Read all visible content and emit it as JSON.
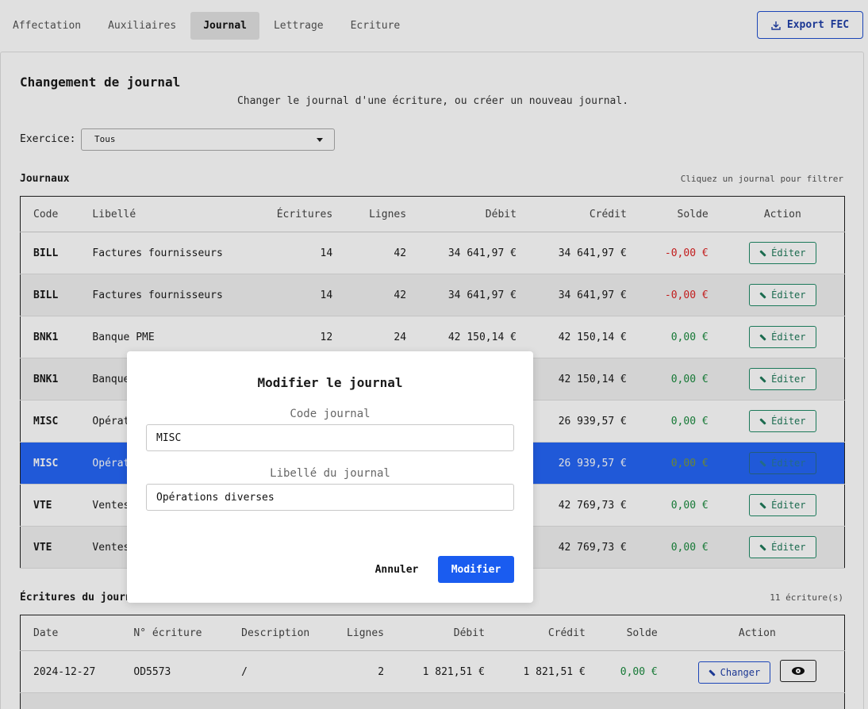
{
  "tabs": [
    {
      "label": "Affectation"
    },
    {
      "label": "Auxiliaires"
    },
    {
      "label": "Journal"
    },
    {
      "label": "Lettrage"
    },
    {
      "label": "Ecriture"
    }
  ],
  "export_label": "Export FEC",
  "page": {
    "title": "Changement de journal",
    "subtitle": "Changer le journal d'une écriture, ou créer un nouveau journal.",
    "exercice_label": "Exercice:",
    "exercice_value": "Tous"
  },
  "journaux": {
    "title": "Journaux",
    "hint": "Cliquez un journal pour filtrer",
    "headers": [
      "Code",
      "Libellé",
      "Écritures",
      "Lignes",
      "Débit",
      "Crédit",
      "Solde",
      "Action"
    ],
    "edit_label": "Éditer",
    "rows": [
      {
        "code": "BILL",
        "libelle": "Factures fournisseurs",
        "ecritures": "14",
        "lignes": "42",
        "debit": "34 641,97 €",
        "credit": "34 641,97 €",
        "solde": "-0,00 €"
      },
      {
        "code": "BILL",
        "libelle": "Factures fournisseurs",
        "ecritures": "14",
        "lignes": "42",
        "debit": "34 641,97 €",
        "credit": "34 641,97 €",
        "solde": "-0,00 €"
      },
      {
        "code": "BNK1",
        "libelle": "Banque PME",
        "ecritures": "12",
        "lignes": "24",
        "debit": "42 150,14 €",
        "credit": "42 150,14 €",
        "solde": "0,00 €"
      },
      {
        "code": "BNK1",
        "libelle": "Banque",
        "ecritures": "",
        "lignes": "",
        "debit": "",
        "credit": "42 150,14 €",
        "solde": "0,00 €"
      },
      {
        "code": "MISC",
        "libelle": "Opérat",
        "ecritures": "",
        "lignes": "",
        "debit": "",
        "credit": "26 939,57 €",
        "solde": "0,00 €"
      },
      {
        "code": "MISC",
        "libelle": "Opérat",
        "ecritures": "",
        "lignes": "",
        "debit": "",
        "credit": "26 939,57 €",
        "solde": "0,00 €"
      },
      {
        "code": "VTE",
        "libelle": "Ventes",
        "ecritures": "",
        "lignes": "",
        "debit": "",
        "credit": "42 769,73 €",
        "solde": "0,00 €"
      },
      {
        "code": "VTE",
        "libelle": "Ventes",
        "ecritures": "",
        "lignes": "",
        "debit": "",
        "credit": "42 769,73 €",
        "solde": "0,00 €"
      }
    ]
  },
  "ecritures": {
    "title": "Écritures du journ",
    "count": "11 écriture(s)",
    "headers": [
      "Date",
      "N° écriture",
      "Description",
      "Lignes",
      "Débit",
      "Crédit",
      "Solde",
      "Action"
    ],
    "change_label": "Changer",
    "rows": [
      {
        "date": "2024-12-27",
        "numero": "OD5573",
        "description": "/",
        "lignes": "2",
        "debit": "1 821,51 €",
        "credit": "1 821,51 €",
        "solde": "0,00 €"
      }
    ]
  },
  "modal": {
    "title": "Modifier le journal",
    "code_label": "Code journal",
    "code_value": "MISC",
    "libelle_label": "Libellé du journal",
    "libelle_value": "Opérations diverses",
    "cancel_label": "Annuler",
    "submit_label": "Modifier"
  },
  "colors": {
    "accent": "#1a5cf0",
    "selected_row": "#2566f6",
    "negative": "#dd2222",
    "positive": "#1a8a3e"
  }
}
